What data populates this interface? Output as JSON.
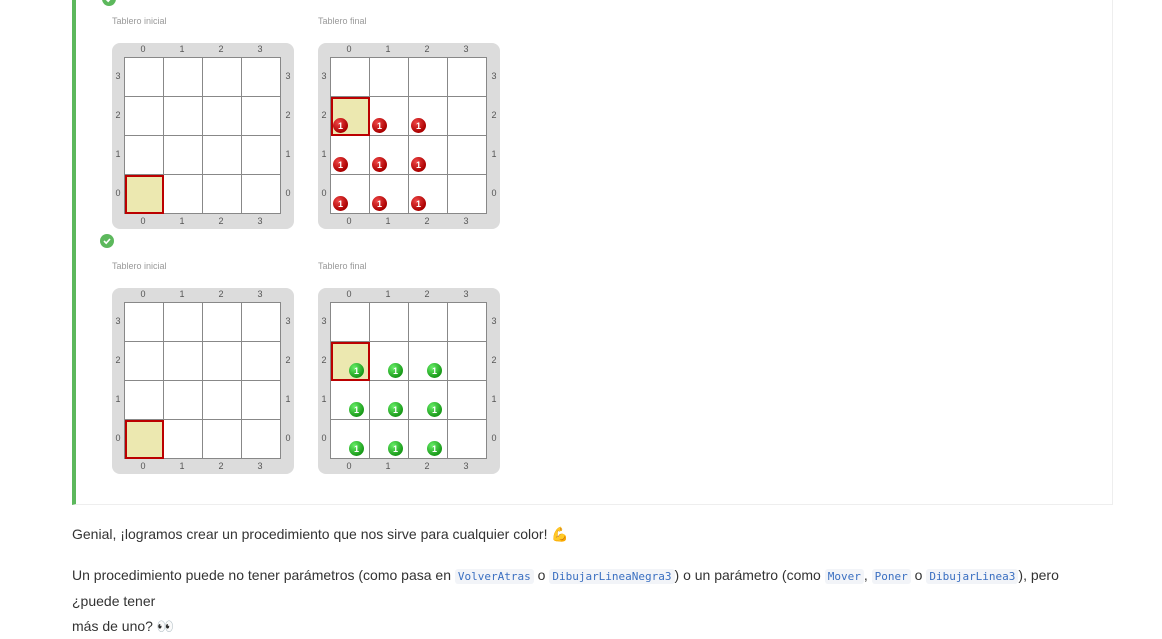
{
  "examples": [
    {
      "initial_label": "Tablero inicial",
      "final_label": "Tablero final",
      "axis": [
        "0",
        "1",
        "2",
        "3"
      ],
      "initial_head": {
        "col": 0,
        "row": 0
      },
      "final_head": {
        "col": 0,
        "row": 2
      },
      "ball_color": "red",
      "ball_value": "1",
      "balls": [
        [
          0,
          2
        ],
        [
          1,
          2
        ],
        [
          2,
          2
        ],
        [
          0,
          1
        ],
        [
          1,
          1
        ],
        [
          2,
          1
        ],
        [
          0,
          0
        ],
        [
          1,
          0
        ],
        [
          2,
          0
        ]
      ]
    },
    {
      "initial_label": "Tablero inicial",
      "final_label": "Tablero final",
      "axis": [
        "0",
        "1",
        "2",
        "3"
      ],
      "initial_head": {
        "col": 0,
        "row": 0
      },
      "final_head": {
        "col": 0,
        "row": 2
      },
      "ball_color": "green",
      "ball_value": "1",
      "balls": [
        [
          0,
          2
        ],
        [
          1,
          2
        ],
        [
          2,
          2
        ],
        [
          0,
          1
        ],
        [
          1,
          1
        ],
        [
          2,
          1
        ],
        [
          0,
          0
        ],
        [
          1,
          0
        ],
        [
          2,
          0
        ]
      ]
    }
  ],
  "paragraph1": {
    "text": "Genial, ¡logramos crear un procedimiento que nos sirve para cualquier color! ",
    "emoji": "💪"
  },
  "paragraph2": {
    "a": "Un procedimiento puede no tener parámetros (como pasa en ",
    "code1": "VolverAtras",
    "b": " o ",
    "code2": "DibujarLineaNegra3",
    "c": ") o un parámetro (como ",
    "code3": "Mover",
    "d": ", ",
    "code4": "Poner",
    "e": " o ",
    "code5": "DibujarLinea3",
    "f": "), pero ¿puede tener",
    "g": "más de uno? ",
    "emoji": "👀"
  },
  "colors": {
    "success": "#5cb85c",
    "head": "#ece8b0",
    "head_border": "#bb0000"
  }
}
